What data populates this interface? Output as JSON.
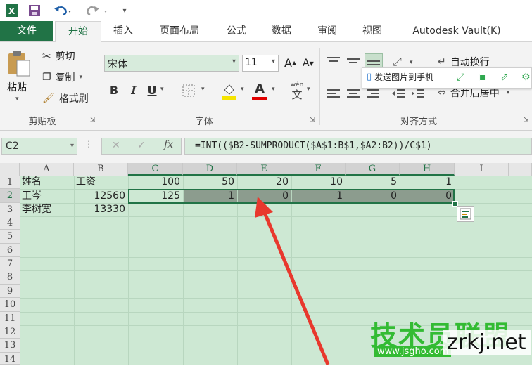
{
  "app": {
    "title": "",
    "icon": "excel-icon"
  },
  "quick_access": {
    "save": "save-icon",
    "undo": "undo-icon",
    "redo": "redo-icon"
  },
  "tabs": [
    "文件",
    "开始",
    "插入",
    "页面布局",
    "公式",
    "数据",
    "审阅",
    "视图",
    "Autodesk Vault(K)"
  ],
  "active_tab": "开始",
  "ribbon": {
    "clipboard": {
      "paste": "粘贴",
      "cut": "剪切",
      "copy": "复制",
      "format_painter": "格式刷",
      "label": "剪贴板"
    },
    "font": {
      "name": "宋体",
      "size": "11",
      "bold": "B",
      "italic": "I",
      "underline": "U",
      "grow": "A",
      "shrink": "A",
      "wen": "wén",
      "wen_char": "文",
      "font_color_letter": "A",
      "label": "字体"
    },
    "alignment": {
      "wrap": "自动换行",
      "merge": "合并后居中",
      "label": "对齐方式"
    },
    "send_bar": {
      "label": "发送图片到手机"
    }
  },
  "formula_bar": {
    "name_box": "C2",
    "formula": "=INT(($B2-SUMPRODUCT($A$1:B$1,$A2:B2))/C$1)"
  },
  "grid": {
    "columns": [
      "A",
      "B",
      "C",
      "D",
      "E",
      "F",
      "G",
      "H",
      "I"
    ],
    "rows": [
      "1",
      "2",
      "3",
      "4",
      "5",
      "6",
      "7",
      "8",
      "9",
      "10",
      "11",
      "12",
      "13",
      "14"
    ],
    "cells": {
      "A1": "姓名",
      "B1": "工资",
      "C1": "100",
      "D1": "50",
      "E1": "20",
      "F1": "10",
      "G1": "5",
      "H1": "1",
      "A2": "王岑",
      "B2": "12560",
      "C2": "125",
      "D2": "1",
      "E2": "0",
      "F2": "1",
      "G2": "0",
      "H2": "0",
      "A3": "李树宽",
      "B3": "13330"
    }
  },
  "colors": {
    "accent": "#217346",
    "cell_bg": "#cde8d3",
    "selection": "#8c9c8e",
    "arrow": "#e8382d"
  },
  "watermark": {
    "cn": "技术员联盟",
    "url": "www.jsgho.com",
    "net": "zrkj.net"
  }
}
